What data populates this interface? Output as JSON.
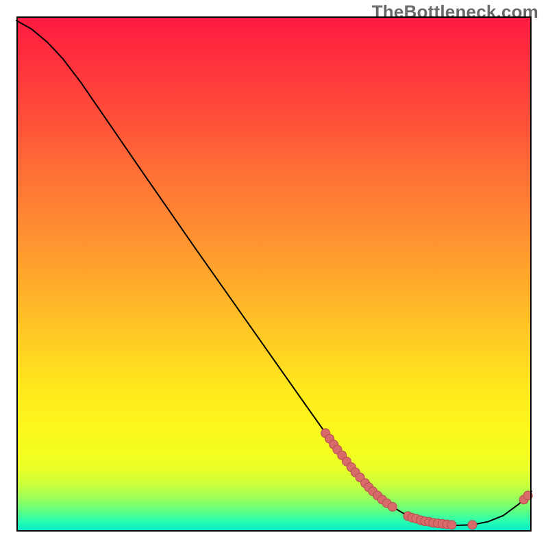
{
  "watermark": "TheBottleneck.com",
  "chart_data": {
    "type": "line",
    "title": "",
    "xlabel": "",
    "ylabel": "",
    "xlim": [
      0,
      100
    ],
    "ylim": [
      0,
      100
    ],
    "grid": false,
    "curve": [
      {
        "x": 0.0,
        "y": 99.2
      },
      {
        "x": 3.0,
        "y": 97.5
      },
      {
        "x": 6.0,
        "y": 95.0
      },
      {
        "x": 9.0,
        "y": 91.8
      },
      {
        "x": 12.5,
        "y": 87.2
      },
      {
        "x": 18.0,
        "y": 79.2
      },
      {
        "x": 25.0,
        "y": 69.0
      },
      {
        "x": 35.0,
        "y": 54.6
      },
      {
        "x": 45.0,
        "y": 40.4
      },
      {
        "x": 55.0,
        "y": 26.2
      },
      {
        "x": 62.0,
        "y": 16.3
      },
      {
        "x": 66.0,
        "y": 11.2
      },
      {
        "x": 69.0,
        "y": 8.0
      },
      {
        "x": 72.0,
        "y": 5.4
      },
      {
        "x": 75.0,
        "y": 3.6
      },
      {
        "x": 78.0,
        "y": 2.4
      },
      {
        "x": 81.5,
        "y": 1.6
      },
      {
        "x": 85.0,
        "y": 1.2
      },
      {
        "x": 88.5,
        "y": 1.3
      },
      {
        "x": 91.5,
        "y": 1.9
      },
      {
        "x": 94.5,
        "y": 3.1
      },
      {
        "x": 97.5,
        "y": 5.3
      },
      {
        "x": 100.0,
        "y": 7.8
      }
    ],
    "markers": [
      {
        "x": 60.0,
        "y": 19.1
      },
      {
        "x": 60.8,
        "y": 18.0
      },
      {
        "x": 61.6,
        "y": 16.9
      },
      {
        "x": 62.3,
        "y": 15.9
      },
      {
        "x": 63.2,
        "y": 14.8
      },
      {
        "x": 64.1,
        "y": 13.6
      },
      {
        "x": 65.0,
        "y": 12.5
      },
      {
        "x": 65.8,
        "y": 11.5
      },
      {
        "x": 66.7,
        "y": 10.5
      },
      {
        "x": 67.7,
        "y": 9.4
      },
      {
        "x": 68.4,
        "y": 8.6
      },
      {
        "x": 69.2,
        "y": 7.8
      },
      {
        "x": 70.1,
        "y": 7.0
      },
      {
        "x": 71.0,
        "y": 6.2
      },
      {
        "x": 71.9,
        "y": 5.5
      },
      {
        "x": 73.0,
        "y": 4.8
      },
      {
        "x": 76.0,
        "y": 3.0
      },
      {
        "x": 76.8,
        "y": 2.7
      },
      {
        "x": 77.6,
        "y": 2.5
      },
      {
        "x": 78.5,
        "y": 2.2
      },
      {
        "x": 79.3,
        "y": 2.0
      },
      {
        "x": 80.1,
        "y": 1.9
      },
      {
        "x": 80.9,
        "y": 1.7
      },
      {
        "x": 81.8,
        "y": 1.6
      },
      {
        "x": 82.7,
        "y": 1.5
      },
      {
        "x": 83.6,
        "y": 1.4
      },
      {
        "x": 84.5,
        "y": 1.3
      },
      {
        "x": 88.5,
        "y": 1.3
      },
      {
        "x": 98.5,
        "y": 6.2
      },
      {
        "x": 99.3,
        "y": 7.0
      }
    ],
    "colors": {
      "curve": "#000000",
      "marker_fill": "#d96a6a",
      "marker_stroke": "#b24e4e"
    }
  }
}
